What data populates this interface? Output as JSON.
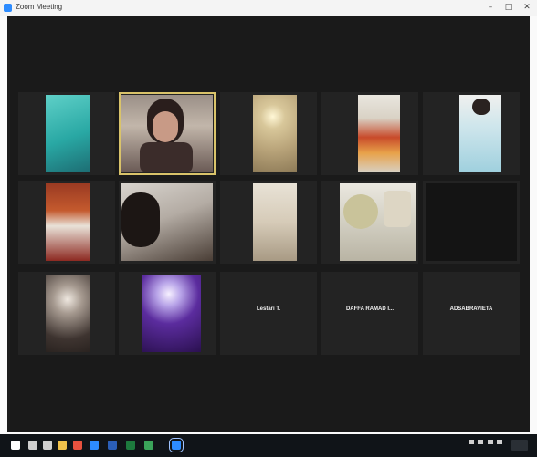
{
  "window": {
    "title": "Zoom Meeting",
    "minimize_glyph": "–",
    "maximize_glyph": "□",
    "close_glyph": "✕"
  },
  "participants": [
    {
      "name": "",
      "kind": "video"
    },
    {
      "name": "",
      "kind": "video",
      "active": true
    },
    {
      "name": "",
      "kind": "video"
    },
    {
      "name": "",
      "kind": "video"
    },
    {
      "name": "",
      "kind": "video"
    },
    {
      "name": "",
      "kind": "video"
    },
    {
      "name": "",
      "kind": "video"
    },
    {
      "name": "",
      "kind": "video"
    },
    {
      "name": "",
      "kind": "video"
    },
    {
      "name": "",
      "kind": "video"
    },
    {
      "name": "",
      "kind": "video"
    },
    {
      "name": "",
      "kind": "video"
    },
    {
      "name": "Lestari T.",
      "kind": "name-only"
    },
    {
      "name": "DAFFA RAMAD I...",
      "kind": "name-only"
    },
    {
      "name": "ADSABRAVIETA",
      "kind": "name-only"
    }
  ],
  "taskbar": {
    "icons": [
      "windows-start-icon",
      "search-icon",
      "task-view-icon",
      "file-explorer-icon",
      "chrome-icon",
      "zoom-icon",
      "word-icon",
      "excel-icon",
      "store-icon",
      "zoom-active-icon"
    ],
    "icon_colors": [
      "#ffffff",
      "#cfcfcf",
      "#cfcfcf",
      "#f0c24b",
      "#e8523f",
      "#2d8cff",
      "#2b5fb8",
      "#1d7a3e",
      "#3aa35a",
      "#2d8cff"
    ]
  },
  "colors": {
    "active_speaker_border": "#d9c36a",
    "stage_background": "#1a1a1a",
    "tile_background": "#232323"
  }
}
